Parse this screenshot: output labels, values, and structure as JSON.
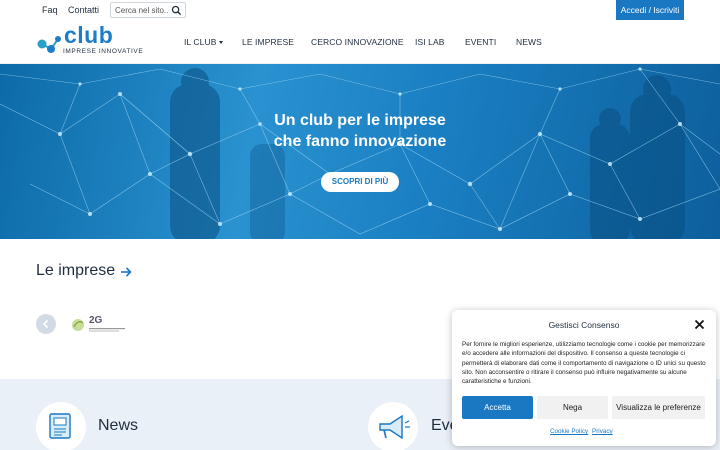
{
  "topbar": {
    "faq": "Faq",
    "contatti": "Contatti",
    "search_placeholder": "Cerca nel sito...",
    "login": "Accedi / Iscriviti"
  },
  "logo": {
    "word": "club",
    "sub": "IMPRESE INNOVATIVE"
  },
  "nav": {
    "il_club": "IL CLUB",
    "le_imprese": "LE IMPRESE",
    "cerco": "CERCO INNOVAZIONE",
    "isi_lab": "ISI LAB",
    "eventi": "EVENTI",
    "news": "NEWS"
  },
  "hero": {
    "line1": "Un club per le imprese",
    "line2": "che fanno innovazione",
    "cta": "SCOPRI DI PIÙ"
  },
  "imprese": {
    "title": "Le imprese",
    "company_logo_text": "2G"
  },
  "bottom": {
    "news": "News",
    "eventi": "Eventi"
  },
  "consent": {
    "title": "Gestisci Consenso",
    "text": "Per fornire le migliori esperienze, utilizziamo tecnologie come i cookie per memorizzare e/o accedere alle informazioni del dispositivo. Il consenso a queste tecnologie ci permetterà di elaborare dati come il comportamento di navigazione o ID unici su questo sito. Non acconsentire o ritirare il consenso può influire negativamente su alcune caratteristiche e funzioni.",
    "accept": "Accetta",
    "deny": "Nega",
    "prefs": "Visualizza le preferenze",
    "cookie_policy": "Cookie Policy",
    "privacy": "Privacy"
  },
  "colors": {
    "brand": "#1a78c2",
    "text": "#1f2d3d",
    "bottom_bg": "#eaf0f7"
  }
}
